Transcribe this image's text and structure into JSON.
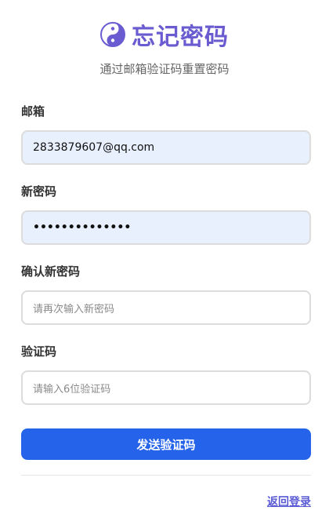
{
  "brand": {
    "icon": "yin-yang-icon",
    "title": "忘记密码",
    "color": "#6a5cd0"
  },
  "subtitle": "通过邮箱验证码重置密码",
  "fields": {
    "email": {
      "label": "邮箱",
      "value": "2833879607@qq.com"
    },
    "new_password": {
      "label": "新密码",
      "masked_value": "••••••••••••••"
    },
    "confirm_password": {
      "label": "确认新密码",
      "placeholder": "请再次输入新密码"
    },
    "code": {
      "label": "验证码",
      "placeholder": "请输入6位验证码"
    }
  },
  "actions": {
    "send_code_label": "发送验证码",
    "back_to_login_label": "返回登录"
  },
  "colors": {
    "primary_button": "#2563eb",
    "autofill_background": "#e8f0fe",
    "link": "#5b5bd6"
  }
}
